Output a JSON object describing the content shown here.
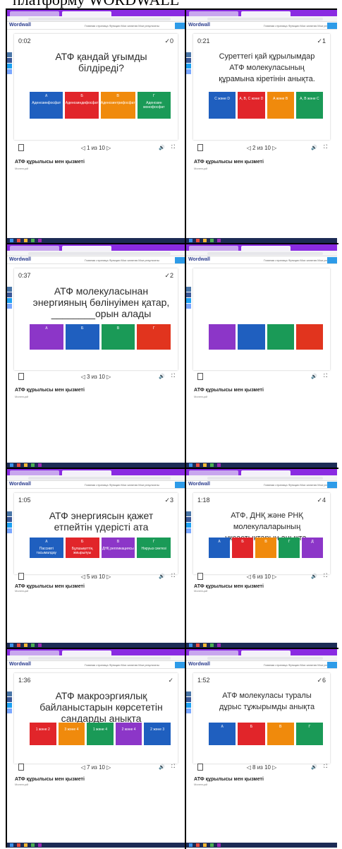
{
  "header": {
    "text": "платформу WORDWALL"
  },
  "site": {
    "logo": "Wordwall",
    "nav": "Главная страница   Функции   Мои занятия   Мои результаты"
  },
  "activity_title": "АТФ құрылысы мен қызметі",
  "author": "Маленцай",
  "shots": [
    {
      "timer": "0:02",
      "score": "✓0",
      "page": "◁ 1 из 10 ▷",
      "question": "АТФ қандай ұғымды білдіреді?",
      "answers": [
        {
          "letter": "А",
          "text": "Аденозинфосфат",
          "color": "#1f5fbf"
        },
        {
          "letter": "Б",
          "text": "Аденозиндифосфат",
          "color": "#e1252a"
        },
        {
          "letter": "В",
          "text": "Аденозинтрифосфат",
          "color": "#f08a0c"
        },
        {
          "letter": "Г",
          "text": "Аденозин монофосфат",
          "color": "#1a9a57"
        }
      ]
    },
    {
      "timer": "0:21",
      "score": "✓1",
      "page": "◁ 2 из 10 ▷",
      "question": "Суреттегі қай құрылымдар АТФ молекуласының құрамына кіретінін анықта.",
      "answers": [
        {
          "letter": "",
          "text": "С және D",
          "color": "#1f5fbf"
        },
        {
          "letter": "",
          "text": "А, В, С және D",
          "color": "#e1252a"
        },
        {
          "letter": "",
          "text": "А және В",
          "color": "#f08a0c"
        },
        {
          "letter": "",
          "text": "А, В және С",
          "color": "#1a9a57"
        }
      ]
    },
    {
      "timer": "0:37",
      "score": "✓2",
      "page": "◁ 3 из 10 ▷",
      "question": "АТФ молекуласынан энергияның бөлінуімен қатар, ________орын алады",
      "answers": [
        {
          "letter": "А",
          "text": "",
          "color": "#8c36c8"
        },
        {
          "letter": "Б",
          "text": "",
          "color": "#1f5fbf"
        },
        {
          "letter": "В",
          "text": "",
          "color": "#1a9a57"
        },
        {
          "letter": "Г",
          "text": "",
          "color": "#e1341e"
        }
      ]
    },
    {
      "timer": "",
      "score": "",
      "page": "",
      "question": "",
      "answers": [
        {
          "letter": "",
          "text": "",
          "color": "#8c36c8"
        },
        {
          "letter": "",
          "text": "",
          "color": "#1f5fbf"
        },
        {
          "letter": "",
          "text": "",
          "color": "#1a9a57"
        },
        {
          "letter": "",
          "text": "",
          "color": "#e1341e"
        }
      ]
    },
    {
      "timer": "1:05",
      "score": "✓3",
      "page": "◁ 5 из 10 ▷",
      "question": "АТФ энергиясын қажет етпейтін үдерісті ата",
      "answers": [
        {
          "letter": "А",
          "text": "Пассивті тасымалдау",
          "color": "#1f5fbf"
        },
        {
          "letter": "Б",
          "text": "Бұлшықеттің жиырылуы",
          "color": "#e1252a"
        },
        {
          "letter": "В",
          "text": "ДНҚ репликациясы",
          "color": "#8c36c8"
        },
        {
          "letter": "Г",
          "text": "Нәруыз синтезі",
          "color": "#1a9a57"
        }
      ]
    },
    {
      "timer": "1:18",
      "score": "✓4",
      "page": "◁ 6 из 10 ▷",
      "question": "АТФ, ДНҚ және РНҚ молекулаларының ұқсастықтарын анықта.",
      "answers": [
        {
          "letter": "А",
          "text": "",
          "color": "#1f5fbf"
        },
        {
          "letter": "Б",
          "text": "",
          "color": "#e1252a"
        },
        {
          "letter": "В",
          "text": "",
          "color": "#f08a0c"
        },
        {
          "letter": "Г",
          "text": "",
          "color": "#1a9a57"
        },
        {
          "letter": "Д",
          "text": "",
          "color": "#8c36c8"
        }
      ]
    },
    {
      "timer": "1:36",
      "score": "✓",
      "page": "◁ 7 из 10 ▷",
      "question": "АТФ макроэргиялық байланыстарын көрсететін сандарды анықта",
      "answers": [
        {
          "letter": "",
          "text": "1 және 2",
          "color": "#e1252a"
        },
        {
          "letter": "",
          "text": "3 және 4",
          "color": "#f08a0c"
        },
        {
          "letter": "",
          "text": "1 және 4",
          "color": "#1a9a57"
        },
        {
          "letter": "",
          "text": "2 және 4",
          "color": "#8c36c8"
        },
        {
          "letter": "",
          "text": "2 және 3",
          "color": "#1f5fbf"
        }
      ]
    },
    {
      "timer": "1:52",
      "score": "✓6",
      "page": "◁ 8 из 10 ▷",
      "question": "АТФ молекуласы туралы дұрыс тұжырымды анықта",
      "answers": [
        {
          "letter": "А",
          "text": "",
          "color": "#1f5fbf"
        },
        {
          "letter": "Б",
          "text": "",
          "color": "#e1252a"
        },
        {
          "letter": "В",
          "text": "",
          "color": "#f08a0c"
        },
        {
          "letter": "Г",
          "text": "",
          "color": "#1a9a57"
        }
      ]
    }
  ]
}
